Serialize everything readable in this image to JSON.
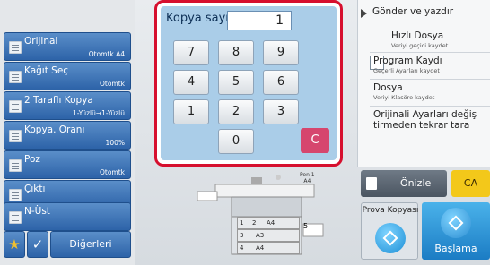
{
  "left_menu": [
    {
      "label": "Orijinal",
      "sub": "Otomtk  A4",
      "icon": "document-icon"
    },
    {
      "label": "Kağıt Seç",
      "sub": "Otomtk",
      "icon": "paper-icon"
    },
    {
      "label": "2 Taraflı Kopya",
      "sub": "1-Yüzlü→1-Yüzlü",
      "icon": "duplex-icon"
    },
    {
      "label": "Kopya. Oranı",
      "sub": "100%",
      "icon": "zoom-icon"
    },
    {
      "label": "Poz",
      "sub": "Otomtk",
      "icon": "exposure-icon"
    },
    {
      "label": "Çıktı",
      "sub": "",
      "icon": "output-icon"
    },
    {
      "label": "N-Üst",
      "sub": "",
      "icon": "n-up-icon"
    }
  ],
  "bottom_left": {
    "star": "★",
    "check": "✓",
    "others_label": "Diğerleri"
  },
  "keypad": {
    "title": "Kopya sayısı",
    "value": "1",
    "keys": [
      "7",
      "8",
      "9",
      "4",
      "5",
      "6",
      "1",
      "2",
      "3",
      "0"
    ],
    "clear_label": "C"
  },
  "right_panel": {
    "send_label": "Gönder ve yazdır",
    "items": [
      {
        "title": "Hızlı Dosya",
        "sub": "Veriyi geçici kaydet"
      },
      {
        "title": "Program Kaydı",
        "sub": "Geçerli Ayarları kaydet"
      },
      {
        "title": "Dosya",
        "sub": "Veriyi Klasöre kaydet"
      },
      {
        "title": "Orijinali Ayarları değiş tirmeden tekrar tara",
        "sub": ""
      }
    ]
  },
  "actions": {
    "preview_label": "Önizle",
    "ca_label": "CA",
    "proof_label": "Prova Kopyası",
    "start_label": "Başlama"
  },
  "machine": {
    "tray_label": "Pen 1\nA4",
    "slots": [
      {
        "num": "1",
        "size": "A4"
      },
      {
        "num": "3",
        "size": "A3"
      },
      {
        "num": "4",
        "size": "A4"
      }
    ],
    "slot2_num": "2",
    "slot5_num": "5",
    "slot_small": "A4"
  },
  "colors": {
    "frame_highlight": "#d60f2e",
    "keypad_bg": "#aacde8",
    "clear_key": "#d6466e",
    "ca_button": "#f3c81a",
    "start_button": "#1b7cc4"
  }
}
